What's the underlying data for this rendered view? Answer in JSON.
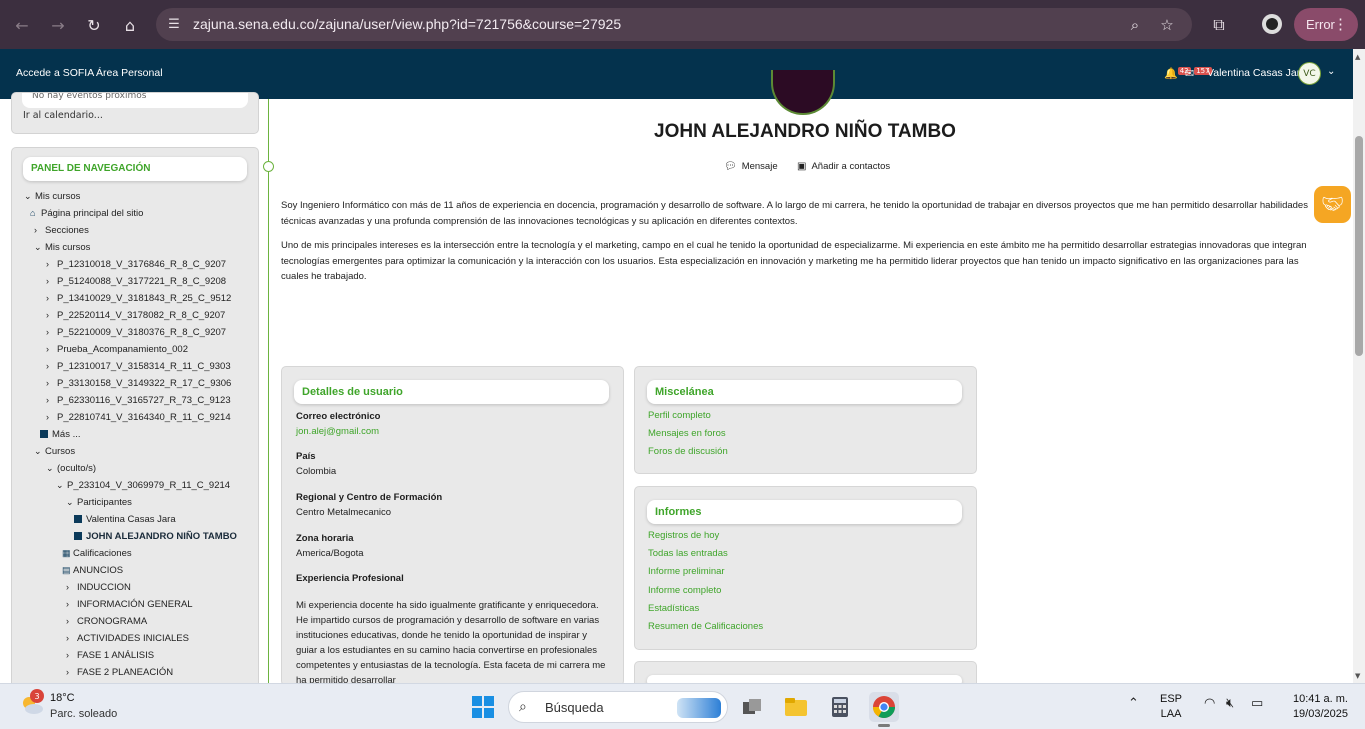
{
  "browser": {
    "url": "zajuna.sena.edu.co/zajuna/user/view.php?id=721756&course=27925",
    "error_label": "Error"
  },
  "navbar": {
    "link1": "Accede a SOFIA",
    "link2": "Área Personal",
    "notif_count": "42",
    "msg_count": "157",
    "user_name": "Valentina Casas Jara",
    "avatar_initials": "VC"
  },
  "left": {
    "calendar_link": "Ir al calendario...",
    "top_strip_text": "No hay eventos próximos",
    "nav_title": "PANEL DE NAVEGACIÓN",
    "tree": [
      {
        "label": "Mis cursos",
        "chev": "v"
      },
      {
        "label": "Página principal del sitio",
        "chev": "home"
      },
      {
        "label": "Secciones",
        "chev": ">"
      },
      {
        "label": "Mis cursos",
        "chev": "v"
      },
      {
        "label": "P_12310018_V_3176846_R_8_C_9207",
        "chev": ">"
      },
      {
        "label": "P_51240088_V_3177221_R_8_C_9208",
        "chev": ">"
      },
      {
        "label": "P_13410029_V_3181843_R_25_C_9512",
        "chev": ">"
      },
      {
        "label": "P_22520114_V_3178082_R_8_C_9207",
        "chev": ">"
      },
      {
        "label": "P_52210009_V_3180376_R_8_C_9207",
        "chev": ">"
      },
      {
        "label": "Prueba_Acompanamiento_002",
        "chev": ">"
      },
      {
        "label": "P_12310017_V_3158314_R_11_C_9303",
        "chev": ">"
      },
      {
        "label": "P_33130158_V_3149322_R_17_C_9306",
        "chev": ">"
      },
      {
        "label": "P_62330116_V_3165727_R_73_C_9123",
        "chev": ">"
      },
      {
        "label": "P_22810741_V_3164340_R_11_C_9214",
        "chev": ">"
      },
      {
        "label": "Más ...",
        "chev": "sq"
      },
      {
        "label": "Cursos",
        "chev": "v"
      },
      {
        "label": "(oculto/s)",
        "chev": "v"
      },
      {
        "label": "P_233104_V_3069979_R_11_C_9214",
        "chev": "v"
      },
      {
        "label": "Participantes",
        "chev": "v"
      },
      {
        "label": "Valentina Casas Jara",
        "chev": "sq"
      },
      {
        "label": "JOHN ALEJANDRO NIÑO TAMBO",
        "chev": "sq"
      },
      {
        "label": "Calificaciones",
        "chev": "grid"
      },
      {
        "label": "ANUNCIOS",
        "chev": "forum"
      },
      {
        "label": "INDUCCION",
        "chev": ">"
      },
      {
        "label": "INFORMACIÓN GENERAL",
        "chev": ">"
      },
      {
        "label": "CRONOGRAMA",
        "chev": ">"
      },
      {
        "label": "ACTIVIDADES INICIALES",
        "chev": ">"
      },
      {
        "label": "FASE 1 ANÁLISIS",
        "chev": ">"
      },
      {
        "label": "FASE 2 PLANEACIÓN",
        "chev": ">"
      }
    ]
  },
  "profile": {
    "name": "JOHN ALEJANDRO NIÑO TAMBO",
    "message_label": "Mensaje",
    "add_contact_label": "Añadir a contactos",
    "bio_p1": "Soy Ingeniero Informático con más de 11 años de experiencia en docencia, programación y desarrollo de software. A lo largo de mi carrera, he tenido la oportunidad de trabajar en diversos proyectos que me han permitido desarrollar habilidades técnicas avanzadas y una profunda comprensión de las innovaciones tecnológicas y su aplicación en diferentes contextos.",
    "bio_p2": "Uno de mis principales intereses es la intersección entre la tecnología y el marketing, campo en el cual he tenido la oportunidad de especializarme. Mi experiencia en este ámbito me ha permitido desarrollar estrategias innovadoras que integran tecnologías emergentes para optimizar la comunicación y la interacción con los usuarios. Esta especialización en innovación y marketing me ha permitido liderar proyectos que han tenido un impacto significativo en las organizaciones para las cuales he trabajado."
  },
  "details": {
    "title": "Detalles de usuario",
    "email_label": "Correo electrónico",
    "email": "jon.alej@gmail.com",
    "country_label": "País",
    "country": "Colombia",
    "regional_label": "Regional y Centro de Formación",
    "regional": "Centro Metalmecanico",
    "tz_label": "Zona horaria",
    "tz": "America/Bogota",
    "exp_label": "Experiencia Profesional",
    "exp_text": "Mi experiencia docente ha sido igualmente gratificante y enriquecedora. He impartido cursos de programación y desarrollo de software en varias instituciones educativas, donde he tenido la oportunidad de inspirar y guiar a los estudiantes en su camino hacia convertirse en profesionales competentes y entusiastas de la tecnología. Esta faceta de mi carrera me ha permitido desarrollar"
  },
  "misc": {
    "title": "Miscelánea",
    "links": [
      "Perfil completo",
      "Mensajes en foros",
      "Foros de discusión"
    ]
  },
  "reports": {
    "title": "Informes",
    "links": [
      "Registros de hoy",
      "Todas las entradas",
      "Informe preliminar",
      "Informe completo",
      "Estadísticas",
      "Resumen de Calificaciones"
    ]
  },
  "taskbar": {
    "weather_badge": "3",
    "temp": "18°C",
    "condition": "Parc. soleado",
    "search_placeholder": "Búsqueda",
    "lang1": "ESP",
    "lang2": "LAA",
    "time": "10:41 a. m.",
    "date": "19/03/2025"
  }
}
